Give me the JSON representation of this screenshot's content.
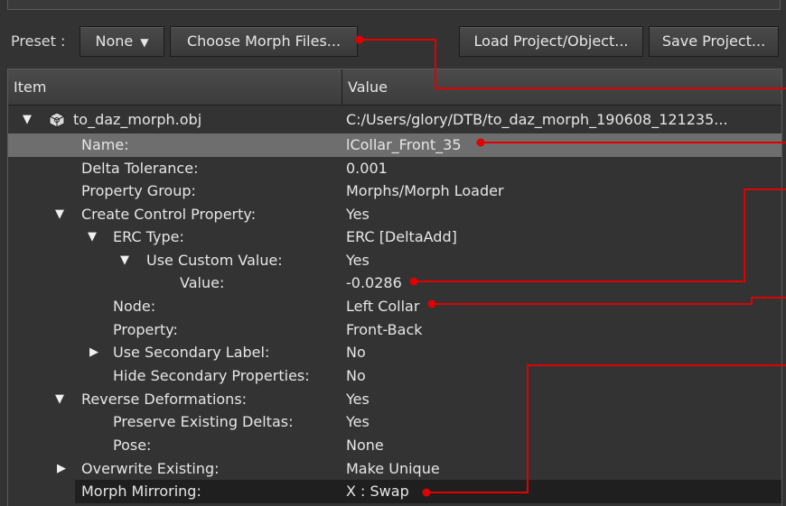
{
  "toolbar": {
    "preset_label": "Preset :",
    "preset_value": "None",
    "choose_morph_label": "Choose Morph Files...",
    "load_label": "Load Project/Object...",
    "save_label": "Save Project..."
  },
  "table": {
    "col_item": "Item",
    "col_value": "Value"
  },
  "rows": [
    {
      "item": "to_daz_morph.obj",
      "value": "C:/Users/glory/DTB/to_daz_morph_190608_121235..."
    },
    {
      "item": "Name:",
      "value": "lCollar_Front_35"
    },
    {
      "item": "Delta Tolerance:",
      "value": "0.001"
    },
    {
      "item": "Property Group:",
      "value": "Morphs/Morph Loader"
    },
    {
      "item": "Create Control Property:",
      "value": "Yes"
    },
    {
      "item": "ERC Type:",
      "value": "ERC [DeltaAdd]"
    },
    {
      "item": "Use Custom Value:",
      "value": "Yes"
    },
    {
      "item": "Value:",
      "value": "-0.0286"
    },
    {
      "item": "Node:",
      "value": "Left Collar"
    },
    {
      "item": "Property:",
      "value": "Front-Back"
    },
    {
      "item": "Use Secondary Label:",
      "value": "No"
    },
    {
      "item": "Hide Secondary Properties:",
      "value": "No"
    },
    {
      "item": "Reverse Deformations:",
      "value": "Yes"
    },
    {
      "item": "Preserve Existing Deltas:",
      "value": "Yes"
    },
    {
      "item": "Pose:",
      "value": "None"
    },
    {
      "item": "Overwrite Existing:",
      "value": "Make Unique"
    },
    {
      "item": "Morph Mirroring:",
      "value": "X : Swap"
    }
  ],
  "colors": {
    "annotation": "#e00000",
    "selected_row": "#6e6e6e",
    "dark_row": "#1f1f1f",
    "panel_bg": "#333333"
  },
  "icons": [
    "dropdown-arrow-icon",
    "expand-arrow-icon",
    "collapse-arrow-icon",
    "object-cube-icon"
  ]
}
